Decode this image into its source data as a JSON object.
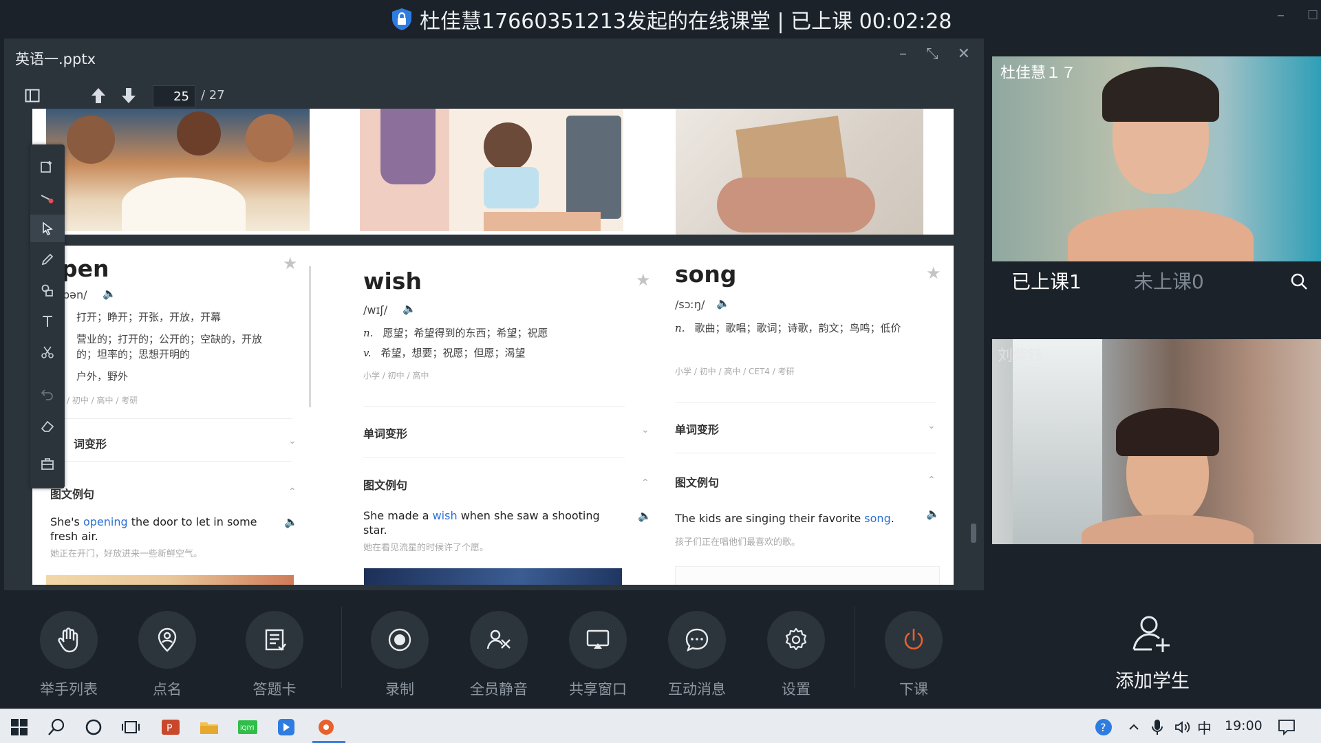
{
  "window": {
    "title": "杜佳慧17660351213发起的在线课堂 | 已上课 00:02:28"
  },
  "presentation": {
    "file_name": "英语一.pptx",
    "page_current": "25",
    "page_total": "/ 27"
  },
  "slide": {
    "cards": [
      {
        "word": "pen",
        "phonetic": "pən/",
        "definitions": [
          "打开；睁开；开张，开放，开幕",
          "营业的；打开的；公开的；空缺的，开放",
          "的；坦率的；思想开明的",
          "户外，野外"
        ],
        "levels": "/ 初中 / 高中 / 考研",
        "section_forms": "词变形",
        "section_examples": "图文例句",
        "example_pre": "She's ",
        "example_word": "opening",
        "example_post": " the door to let in some fresh air.",
        "translation": "她正在开门，好放进来一些新鲜空气。"
      },
      {
        "word": "wish",
        "phonetic": "/wɪʃ/",
        "pos_n": "n.",
        "def_n": "愿望；希望得到的东西；希望；祝愿",
        "pos_v": "v.",
        "def_v": "希望，想要；祝愿；但愿；渴望",
        "levels": "小学 / 初中 / 高中",
        "section_forms": "单词变形",
        "section_examples": "图文例句",
        "example_pre": "She made a ",
        "example_word": "wish",
        "example_post": " when she saw a shooting star.",
        "translation": "她在看见流星的时候许了个愿。"
      },
      {
        "word": "song",
        "phonetic": "/sɔːŋ/",
        "pos_n": "n.",
        "def_n": "歌曲；歌唱；歌词；诗歌，韵文；鸟鸣；低价",
        "levels": "小学 / 初中 / 高中 / CET4 / 考研",
        "section_forms": "单词变形",
        "section_examples": "图文例句",
        "example_pre": "The kids are singing their favorite ",
        "example_word": "song",
        "example_post": ".",
        "translation": "孩子们正在唱他们最喜欢的歌。"
      }
    ]
  },
  "bottom_bar": {
    "buttons": [
      {
        "label": "举手列表",
        "icon": "hand-icon"
      },
      {
        "label": "点名",
        "icon": "location-pin-icon"
      },
      {
        "label": "答题卡",
        "icon": "answer-card-icon"
      },
      {
        "label": "录制",
        "icon": "record-icon"
      },
      {
        "label": "全员静音",
        "icon": "mute-all-icon"
      },
      {
        "label": "共享窗口",
        "icon": "share-window-icon"
      },
      {
        "label": "互动消息",
        "icon": "chat-icon"
      },
      {
        "label": "设置",
        "icon": "gear-icon"
      },
      {
        "label": "下课",
        "icon": "power-icon"
      }
    ]
  },
  "side_panel": {
    "teacher_name": "杜佳慧１７",
    "student_name": "刘紫钰",
    "tab_attended": "已上课1",
    "tab_absent": "未上课0",
    "add_student": "添加学生"
  },
  "taskbar": {
    "ime": "中",
    "time": "19:00"
  },
  "colors": {
    "accent_blue": "#2a6fd6",
    "end_class_red": "#e8612c",
    "window_bg": "#1c2229"
  }
}
